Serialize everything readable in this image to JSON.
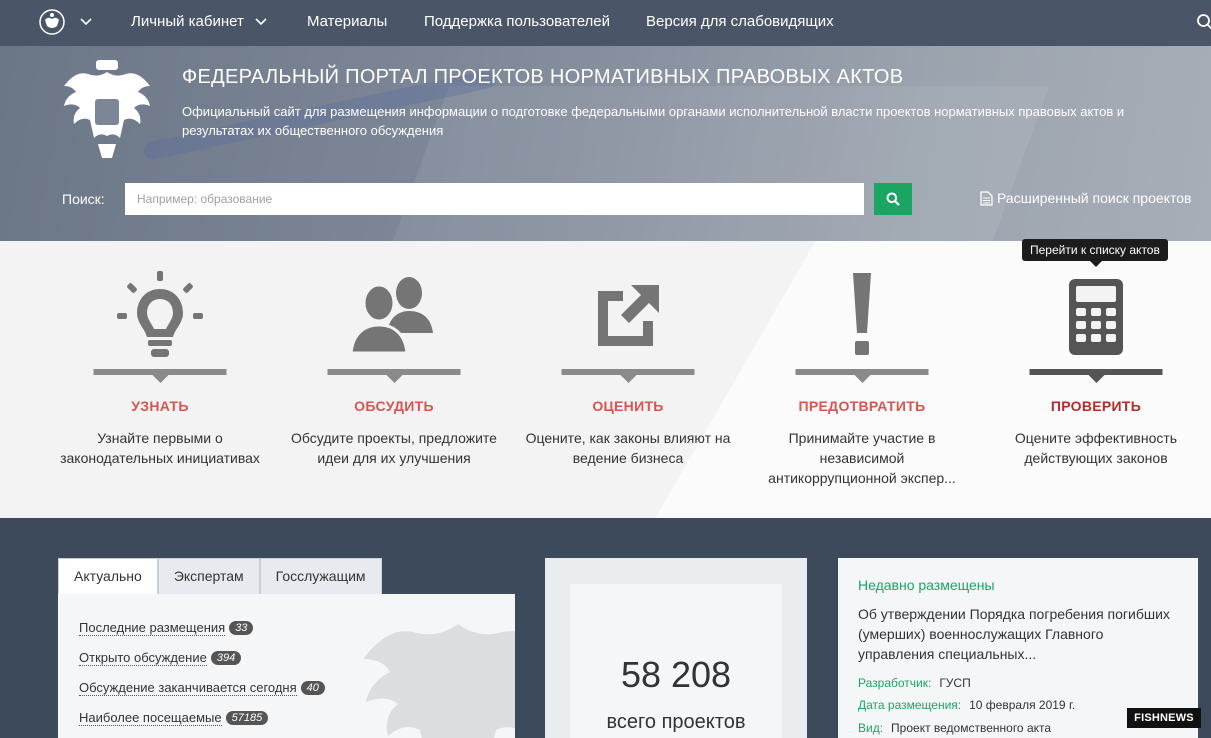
{
  "nav": {
    "items": [
      "Личный кабинет",
      "Материалы",
      "Поддержка пользователей",
      "Версия для слабовидящих"
    ]
  },
  "hero": {
    "title": "ФЕДЕРАЛЬНЫЙ ПОРТАЛ ПРОЕКТОВ НОРМАТИВНЫХ ПРАВОВЫХ АКТОВ",
    "subtitle": "Официальный сайт для размещения информации о подготовке федеральными органами исполнительной власти проектов нормативных правовых актов и результатах их общественного обсуждения",
    "search_label": "Поиск:",
    "search_placeholder": "Например: образование",
    "advanced_search": "Расширенный поиск проектов"
  },
  "features": [
    {
      "title": "УЗНАТЬ",
      "desc": "Узнайте первыми о законодательных инициативах",
      "icon": "lightbulb-icon"
    },
    {
      "title": "ОБСУДИТЬ",
      "desc": "Обсудите проекты, предложите идеи для их улучшения",
      "icon": "people-icon"
    },
    {
      "title": "ОЦЕНИТЬ",
      "desc": "Оцените, как законы влияют на ведение бизнеса",
      "icon": "share-arrow-icon"
    },
    {
      "title": "ПРЕДОТВРАТИТЬ",
      "desc": "Принимайте участие в независимой антикоррупционной экспер...",
      "icon": "exclamation-icon"
    },
    {
      "title": "ПРОВЕРИТЬ",
      "desc": "Оцените эффективность действующих законов",
      "icon": "calculator-icon"
    }
  ],
  "tooltip": "Перейти к списку актов",
  "tabs": [
    "Актуально",
    "Экспертам",
    "Госслужащим"
  ],
  "stats": [
    {
      "label": "Последние размещения",
      "count": "33"
    },
    {
      "label": "Открыто обсуждение",
      "count": "394"
    },
    {
      "label": "Обсуждение заканчивается сегодня",
      "count": "40"
    },
    {
      "label": "Наиболее посещаемые",
      "count": "57185"
    }
  ],
  "total": {
    "number": "58 208",
    "label": "всего проектов"
  },
  "recent": {
    "title": "Недавно размещены",
    "doc": "Об утверждении Порядка погребения погибших (умерших) военнослужащих Главного управления специальных...",
    "developer_key": "Разработчик:",
    "developer_val": "ГУСП",
    "date_key": "Дата размещения:",
    "date_val": "10 февраля 2019 г.",
    "type_key": "Вид:",
    "type_val": "Проект ведомственного акта"
  },
  "watermark": {
    "fish": "FISH",
    "news": "NEWS"
  }
}
